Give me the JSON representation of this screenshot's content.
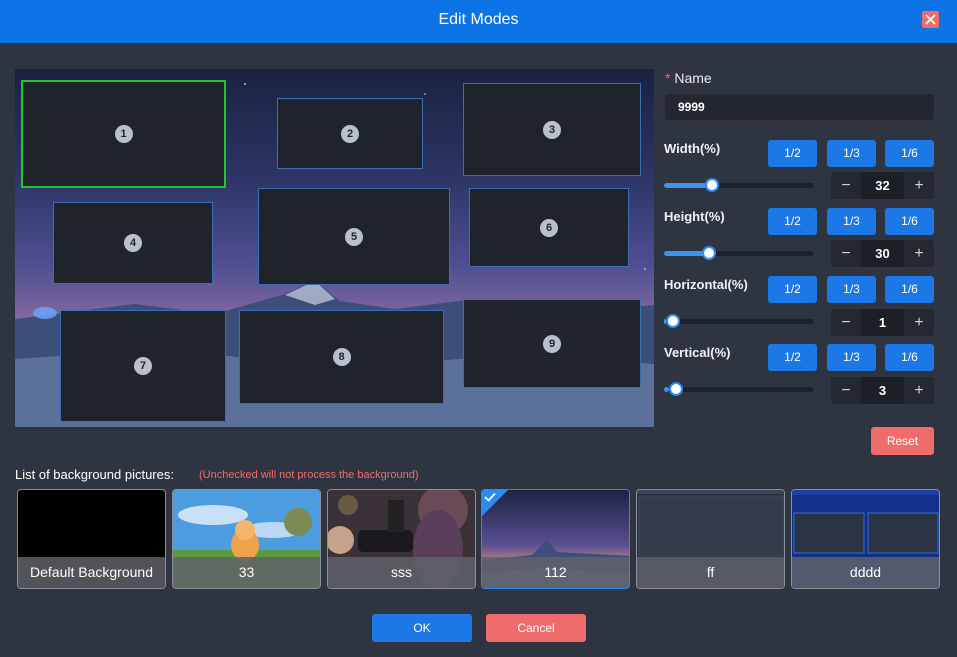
{
  "dialog": {
    "title": "Edit Modes"
  },
  "preview": {
    "regions": [
      {
        "number": "1",
        "active": true
      },
      {
        "number": "2",
        "active": false
      },
      {
        "number": "3",
        "active": false
      },
      {
        "number": "4",
        "active": false
      },
      {
        "number": "5",
        "active": false
      },
      {
        "number": "6",
        "active": false
      },
      {
        "number": "7",
        "active": false
      },
      {
        "number": "8",
        "active": false
      },
      {
        "number": "9",
        "active": false
      }
    ]
  },
  "form": {
    "name_required_mark": "*",
    "name_label": "Name",
    "name_value": "9999",
    "width": {
      "label": "Width(%)",
      "fractions": [
        "1/2",
        "1/3",
        "1/6"
      ],
      "value": "32",
      "slider_fraction": 0.32
    },
    "height": {
      "label": "Height(%)",
      "fractions": [
        "1/2",
        "1/3",
        "1/6"
      ],
      "value": "30",
      "slider_fraction": 0.3
    },
    "horizontal": {
      "label": "Horizontal(%)",
      "fractions": [
        "1/2",
        "1/3",
        "1/6"
      ],
      "value": "1",
      "slider_fraction": 0.01
    },
    "vertical": {
      "label": "Vertical(%)",
      "fractions": [
        "1/2",
        "1/3",
        "1/6"
      ],
      "value": "3",
      "slider_fraction": 0.03
    },
    "minus_symbol": "−",
    "plus_symbol": "+",
    "reset_label": "Reset"
  },
  "backgrounds": {
    "title": "List of background pictures:",
    "hint": "(Unchecked will not process the background)",
    "items": [
      {
        "label": "Default Background",
        "selected": false
      },
      {
        "label": "33",
        "selected": false
      },
      {
        "label": "sss",
        "selected": false
      },
      {
        "label": "112",
        "selected": true
      },
      {
        "label": "ff",
        "selected": false
      },
      {
        "label": "dddd",
        "selected": false
      }
    ]
  },
  "footer": {
    "ok_label": "OK",
    "cancel_label": "Cancel"
  },
  "colors": {
    "accent": "#1b78e6",
    "danger": "#f06b6b",
    "active_region": "#22c52b",
    "header": "#0d74e7"
  }
}
